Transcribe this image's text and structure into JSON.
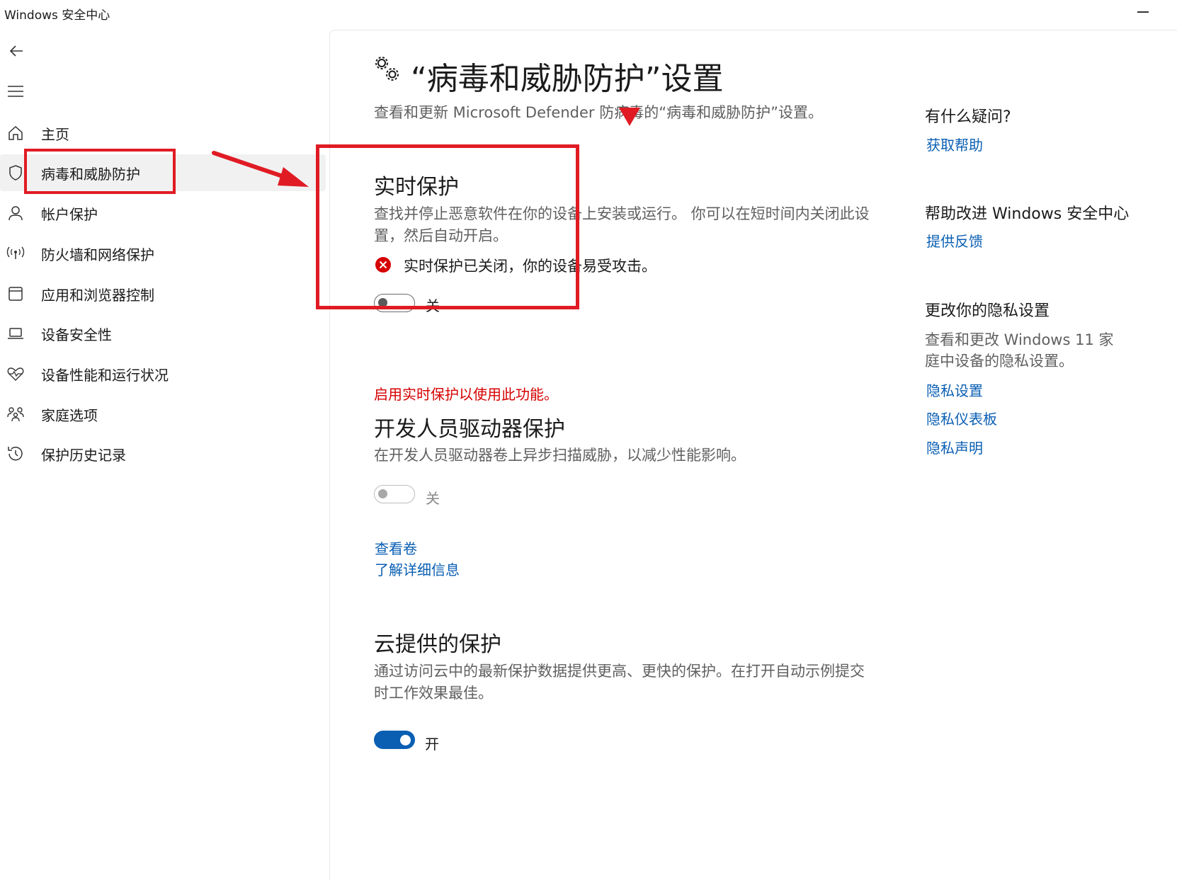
{
  "window": {
    "title": "Windows 安全中心"
  },
  "sidebar": {
    "items": [
      {
        "label": "主页",
        "icon": "home-icon"
      },
      {
        "label": "病毒和威胁防护",
        "icon": "shield-icon",
        "selected": true
      },
      {
        "label": "帐户保护",
        "icon": "person-icon"
      },
      {
        "label": "防火墙和网络保护",
        "icon": "antenna-icon"
      },
      {
        "label": "应用和浏览器控制",
        "icon": "app-window-icon"
      },
      {
        "label": "设备安全性",
        "icon": "laptop-icon"
      },
      {
        "label": "设备性能和运行状况",
        "icon": "heart-pulse-icon"
      },
      {
        "label": "家庭选项",
        "icon": "family-icon"
      },
      {
        "label": "保护历史记录",
        "icon": "history-icon"
      }
    ]
  },
  "page": {
    "title": "“病毒和威胁防护”设置",
    "subtitle": "查看和更新 Microsoft Defender 防病毒的“病毒和威胁防护”设置。"
  },
  "realtime": {
    "title": "实时保护",
    "description": "查找并停止恶意软件在你的设备上安装或运行。 你可以在短时间内关闭此设置，然后自动开启。",
    "status": "实时保护已关闭，你的设备易受攻击。",
    "toggle_label": "关",
    "toggle_on": false
  },
  "devdrive": {
    "warning": "启用实时保护以使用此功能。",
    "title": "开发人员驱动器保护",
    "description": "在开发人员驱动器卷上异步扫描威胁，以减少性能影响。",
    "toggle_label": "关",
    "toggle_on": false,
    "link_volumes": "查看卷",
    "link_learn": "了解详细信息"
  },
  "cloud": {
    "title": "云提供的保护",
    "description": "通过访问云中的最新保护数据提供更高、更快的保护。在打开自动示例提交时工作效果最佳。",
    "toggle_label": "开",
    "toggle_on": true
  },
  "right": {
    "help_heading": "有什么疑问?",
    "help_link": "获取帮助",
    "improve_heading": "帮助改进 Windows 安全中心",
    "improve_link": "提供反馈",
    "privacy_heading": "更改你的隐私设置",
    "privacy_desc": "查看和更改 Windows 11 家庭中设备的隐私设置。",
    "privacy_links": [
      "隐私设置",
      "隐私仪表板",
      "隐私声明"
    ]
  },
  "colors": {
    "accent": "#0a5fb3",
    "error": "#d60000",
    "annotation": "#e01b24"
  }
}
